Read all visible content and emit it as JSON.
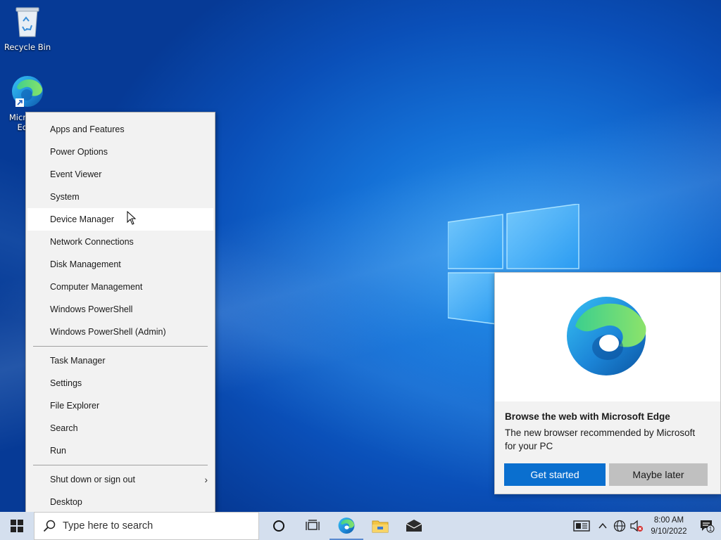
{
  "desktop": {
    "icons": [
      {
        "label": "Recycle Bin",
        "icon": "recycle-bin-icon"
      },
      {
        "label": "Microsoft Edge",
        "icon": "edge-icon"
      }
    ]
  },
  "context_menu": {
    "group1": [
      "Apps and Features",
      "Power Options",
      "Event Viewer",
      "System",
      "Device Manager",
      "Network Connections",
      "Disk Management",
      "Computer Management",
      "Windows PowerShell",
      "Windows PowerShell (Admin)"
    ],
    "group2": [
      "Task Manager",
      "Settings",
      "File Explorer",
      "Search",
      "Run"
    ],
    "group3": [
      "Shut down or sign out",
      "Desktop"
    ],
    "hovered": "Device Manager"
  },
  "edge_promo": {
    "title": "Browse the web with Microsoft Edge",
    "description": "The new browser recommended by Microsoft for your PC",
    "primary_button": "Get started",
    "secondary_button": "Maybe later"
  },
  "taskbar": {
    "search_placeholder": "Type here to search",
    "clock_time": "8:00 AM",
    "clock_date": "9/10/2022",
    "notification_count": "1",
    "colors": {
      "background": "#d4dfee",
      "accent": "#0a6fcf"
    }
  }
}
